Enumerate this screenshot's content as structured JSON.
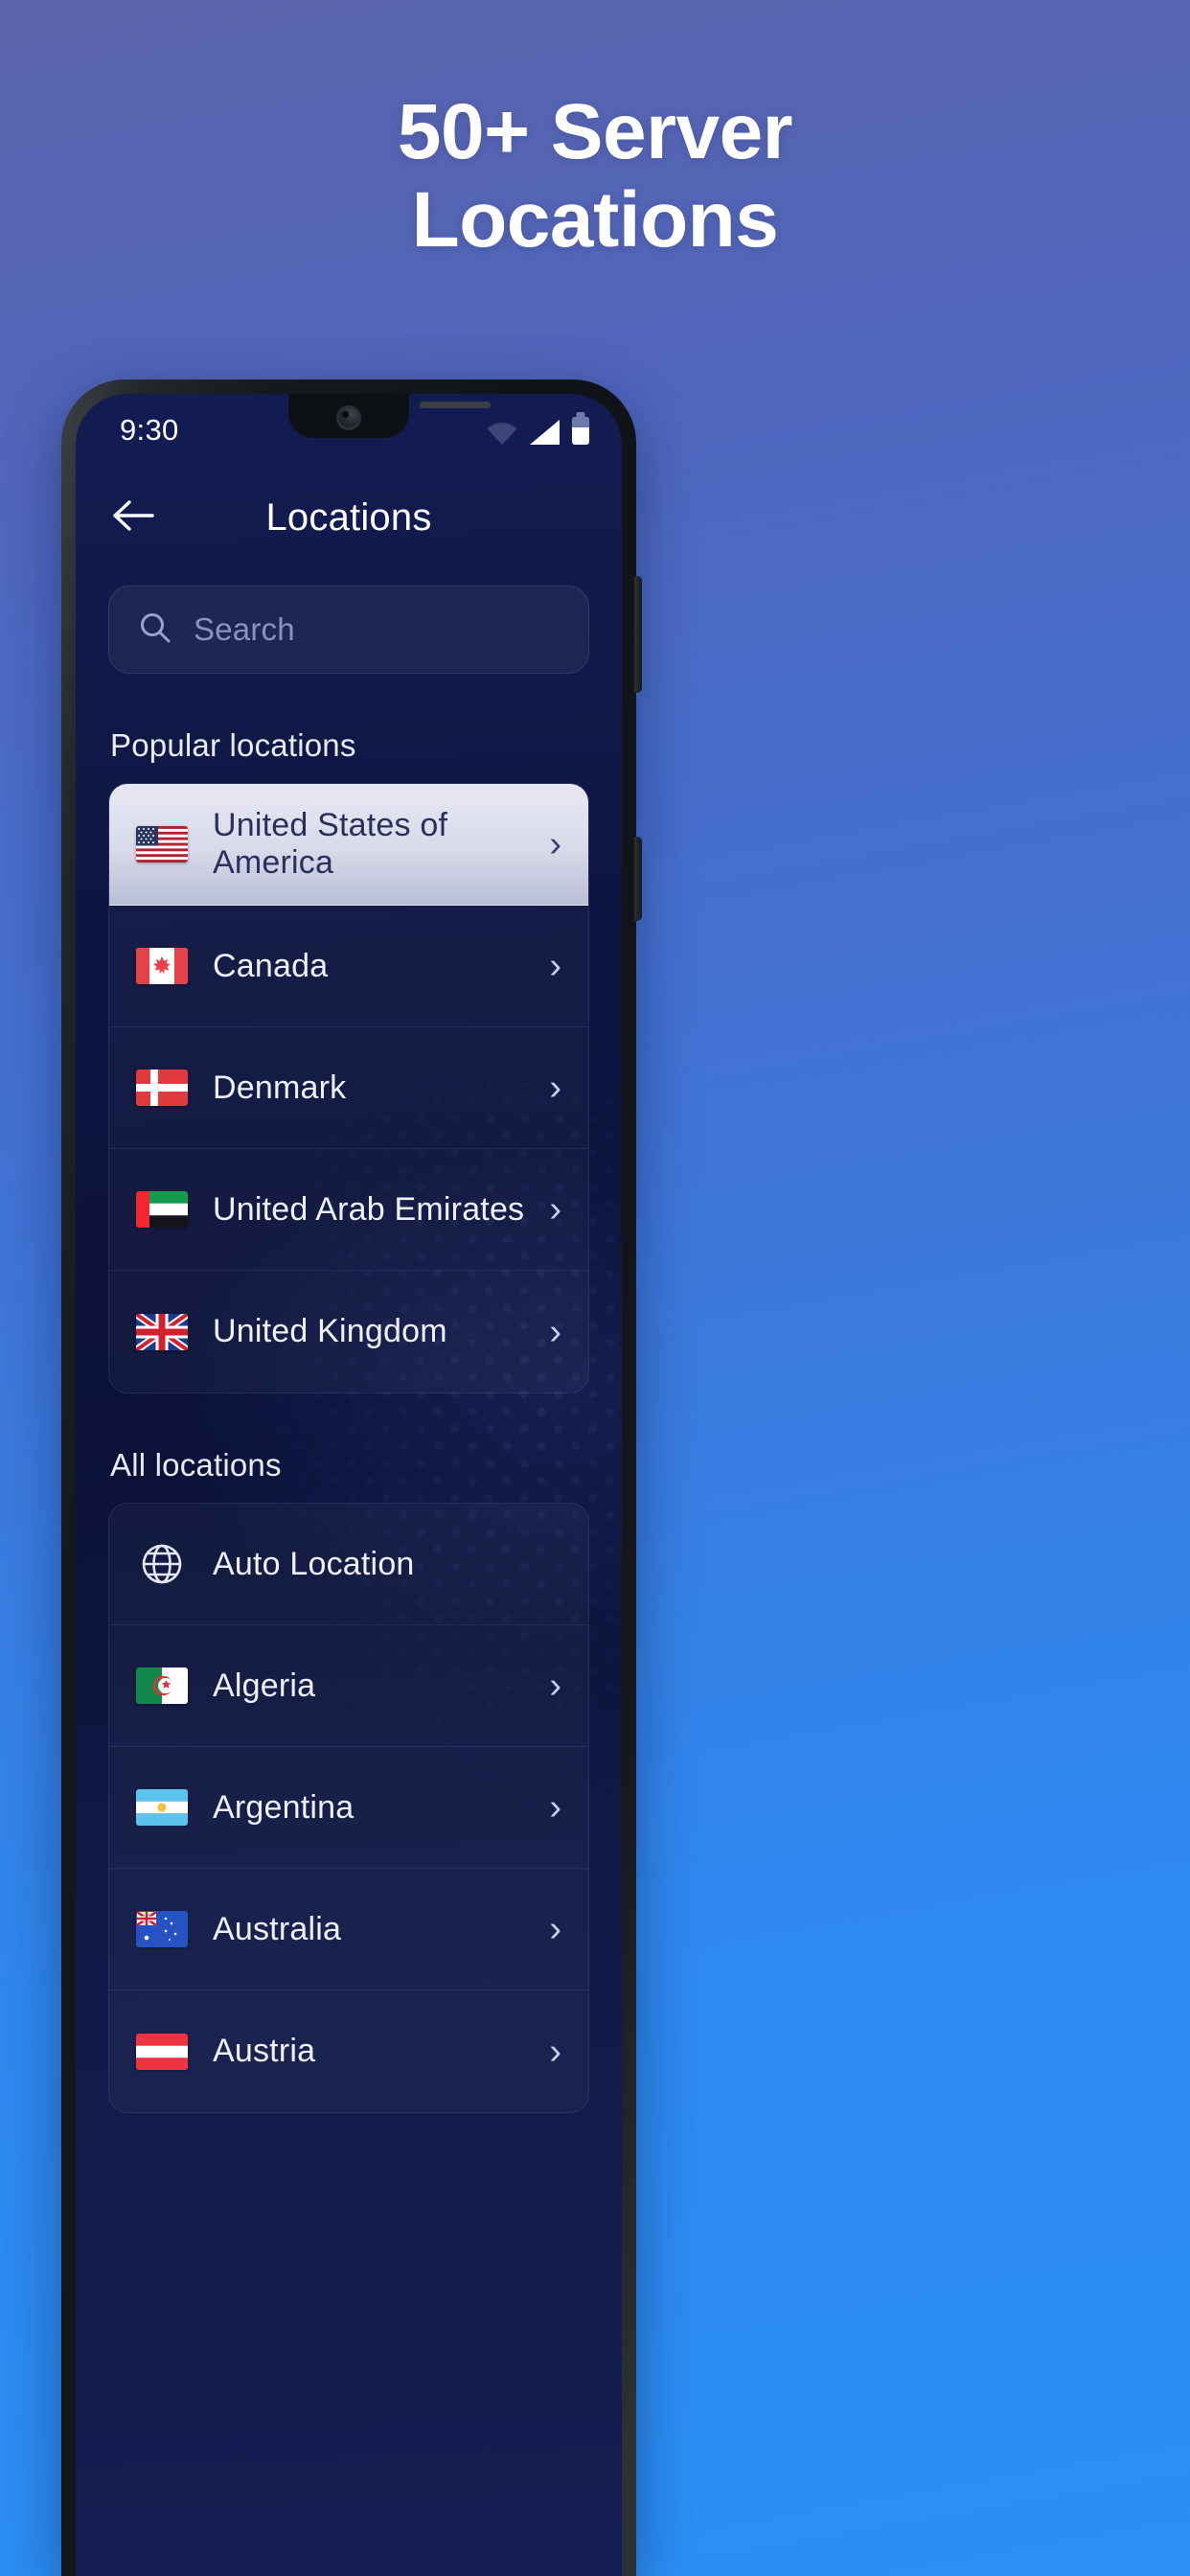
{
  "promo": {
    "headline_line1": "50+ Server",
    "headline_line2": "Locations"
  },
  "phone": {
    "status_bar": {
      "time": "9:30",
      "icons": [
        "wifi-icon",
        "cellular-signal-icon",
        "battery-icon"
      ]
    },
    "app_bar": {
      "back_icon": "arrow-left-icon",
      "title": "Locations"
    },
    "search": {
      "icon": "search-icon",
      "placeholder": "Search",
      "value": ""
    },
    "sections": [
      {
        "title": "Popular locations",
        "items": [
          {
            "label": "United States of America",
            "flag": "us",
            "chevron": "›",
            "selected": true
          },
          {
            "label": "Canada",
            "flag": "ca",
            "chevron": "›",
            "selected": false
          },
          {
            "label": "Denmark",
            "flag": "dk",
            "chevron": "›",
            "selected": false
          },
          {
            "label": "United Arab Emirates",
            "flag": "ae",
            "chevron": "›",
            "selected": false
          },
          {
            "label": "United Kingdom",
            "flag": "gb",
            "chevron": "›",
            "selected": false
          }
        ]
      },
      {
        "title": "All locations",
        "items": [
          {
            "label": "Auto Location",
            "flag": "globe",
            "chevron": "",
            "selected": false
          },
          {
            "label": "Algeria",
            "flag": "dz",
            "chevron": "›",
            "selected": false
          },
          {
            "label": "Argentina",
            "flag": "ar",
            "chevron": "›",
            "selected": false
          },
          {
            "label": "Australia",
            "flag": "au",
            "chevron": "›",
            "selected": false
          },
          {
            "label": "Austria",
            "flag": "at",
            "chevron": "›",
            "selected": false
          }
        ]
      }
    ]
  },
  "colors": {
    "page_bg_top": "#5b63ab",
    "page_bg_bottom": "#2a90f5",
    "screen_bg": "#0d1440",
    "selected_row": "#dcdeec",
    "text_primary": "#eef1fb",
    "text_muted": "#8a93bd"
  }
}
